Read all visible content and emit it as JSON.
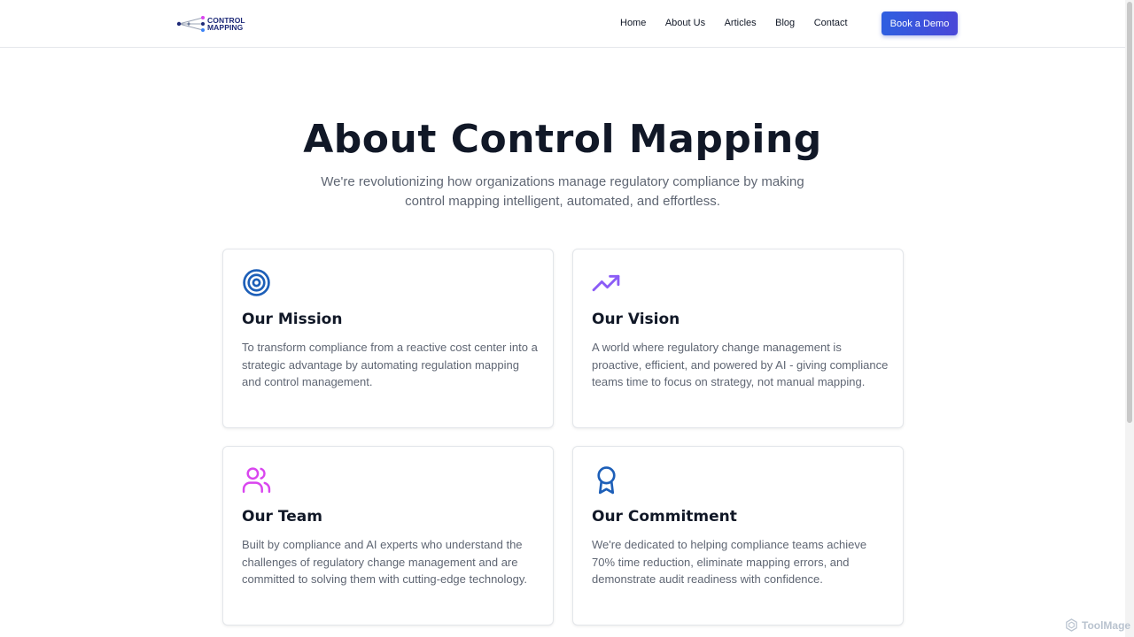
{
  "brand": {
    "line1": "CONTROL",
    "line2": "MAPPING",
    "colors": {
      "primary": "#1e2a78",
      "accent_dot": "#d946ef"
    }
  },
  "nav": {
    "items": [
      {
        "label": "Home"
      },
      {
        "label": "About Us"
      },
      {
        "label": "Articles"
      },
      {
        "label": "Blog"
      },
      {
        "label": "Contact"
      }
    ],
    "cta_label": "Book a Demo",
    "cta_color": "#3b55e0"
  },
  "hero": {
    "title": "About Control Mapping",
    "subtitle": "We're revolutionizing how organizations manage regulatory compliance by making control mapping intelligent, automated, and effortless."
  },
  "cards": [
    {
      "icon": "target-icon",
      "icon_color": "#1d5fb8",
      "title": "Our Mission",
      "text": "To transform compliance from a reactive cost center into a strategic advantage by automating regulation mapping and control management."
    },
    {
      "icon": "trending-up-icon",
      "icon_color": "#8b5cf6",
      "title": "Our Vision",
      "text": "A world where regulatory change management is proactive, efficient, and powered by AI - giving compliance teams time to focus on strategy, not manual mapping."
    },
    {
      "icon": "users-icon",
      "icon_color": "#d946ef",
      "title": "Our Team",
      "text": "Built by compliance and AI experts who understand the challenges of regulatory change management and are committed to solving them with cutting-edge technology."
    },
    {
      "icon": "award-icon",
      "icon_color": "#1d5fb8",
      "title": "Our Commitment",
      "text": "We're dedicated to helping compliance teams achieve 70% time reduction, eliminate mapping errors, and demonstrate audit readiness with confidence."
    }
  ],
  "watermark": {
    "text": "ToolMage"
  }
}
